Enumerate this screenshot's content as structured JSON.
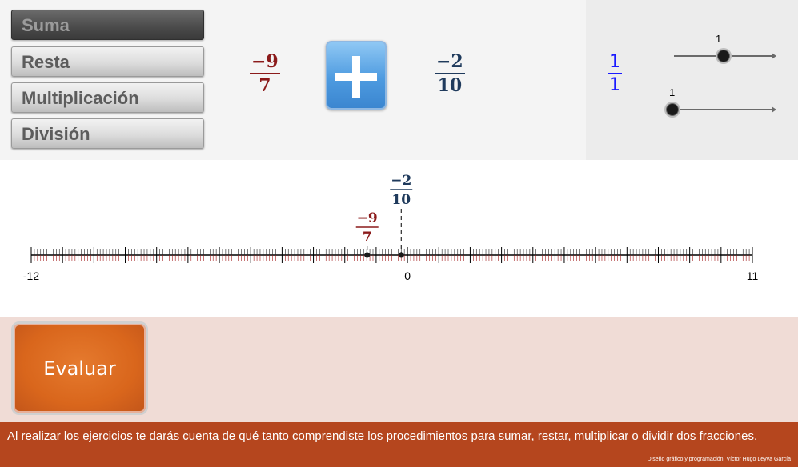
{
  "operations": [
    {
      "label": "Suma",
      "active": true
    },
    {
      "label": "Resta",
      "active": false
    },
    {
      "label": "Multiplicación",
      "active": false
    },
    {
      "label": "División",
      "active": false
    }
  ],
  "fraction_a": {
    "num": "−9",
    "den": "7",
    "color": "#8b1a1a"
  },
  "fraction_b": {
    "num": "−2",
    "den": "10",
    "color": "#1f3a5c"
  },
  "operator_icon": "plus-icon",
  "result_fraction": {
    "num": "1",
    "den": "1",
    "color": "#1a1aff"
  },
  "sliders": [
    {
      "value_label": "1",
      "level": 0.5
    },
    {
      "value_label": "1",
      "level": 0.0
    }
  ],
  "number_line": {
    "min": -12,
    "max": 11,
    "min_label": "-12",
    "zero_label": "0",
    "max_label": "11",
    "subdivisions": 10,
    "points": [
      {
        "value": -1.2857,
        "num": "−9",
        "den": "7",
        "color": "#8b1a1a"
      },
      {
        "value": -0.2,
        "num": "−2",
        "den": "10",
        "color": "#1f3a5c"
      }
    ]
  },
  "evaluate_button": {
    "label": "Evaluar"
  },
  "footer": {
    "message": "Al realizar los ejercicios te darás cuenta de qué tanto comprendiste los procedimientos  para sumar, restar, multiplicar o dividir dos fracciones.",
    "credit": "Diseño gráfico y programación: Víctor Hugo Leyva García"
  }
}
